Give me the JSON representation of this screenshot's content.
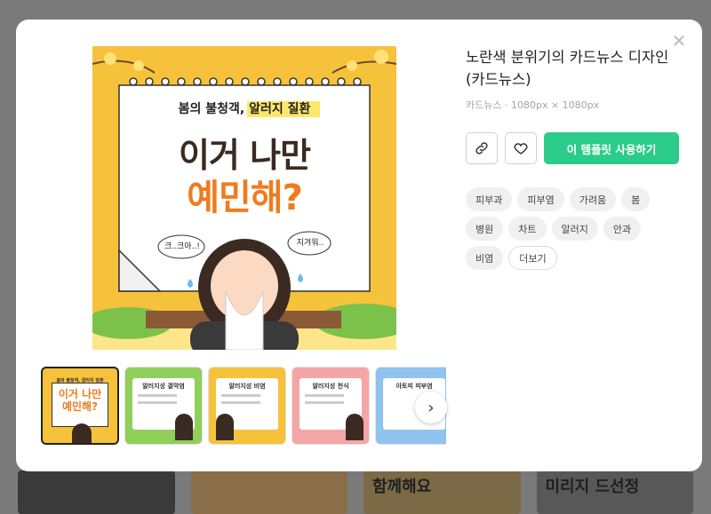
{
  "template": {
    "title": "노란색 분위기의 카드뉴스 디자인 (카드뉴스)",
    "meta": "카드뉴스 · 1080px × 1080px",
    "use_button": "이 템플릿 사용하기"
  },
  "preview": {
    "headline_top": "봄의 불청객, ",
    "headline_highlight": "알러지 질환",
    "main_line1": "이거 나만",
    "main_line2": "예민해?",
    "bubble_left": "크..크아..!",
    "bubble_right": "지겨워.."
  },
  "tags": [
    "피부과",
    "피부염",
    "가려움",
    "봄",
    "병원",
    "차트",
    "알러지",
    "안과",
    "비염"
  ],
  "more_label": "더보기",
  "thumbnails": [
    {
      "title": "이거 나만 예민해?",
      "top": "봄의 불청객, 알러지 질환",
      "accent": "#f6c23b"
    },
    {
      "title": "알러지성 결막염",
      "top": "",
      "accent": "#8fcf5a"
    },
    {
      "title": "알러지성 비염",
      "top": "",
      "accent": "#f6c23b"
    },
    {
      "title": "알러지성 천식",
      "top": "",
      "accent": "#f4a6a6"
    },
    {
      "title": "아토피 피부염",
      "top": "",
      "accent": "#8fc3f0"
    }
  ],
  "background": {
    "card_text_3": "함께해요",
    "card_text_4": "미리지 드선정"
  },
  "colors": {
    "accent_green": "#2bcb8a",
    "preview_yellow": "#f6c23b",
    "orange_text": "#f07b1e"
  }
}
